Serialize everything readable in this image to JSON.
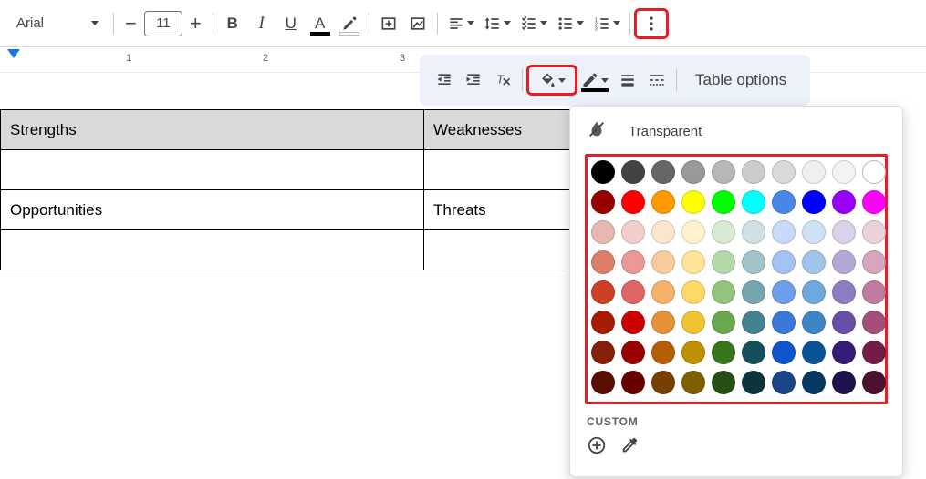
{
  "toolbar": {
    "font_name": "Arial",
    "font_size": "11",
    "text_color_bar": "#000000",
    "highlight_bar": "#ffffff"
  },
  "secondary_toolbar": {
    "border_color_bar": "#000000",
    "table_options_label": "Table options"
  },
  "ruler": {
    "n1": "1",
    "n2": "2",
    "n3": "3"
  },
  "table": {
    "r0c0": "Strengths",
    "r0c1": "Weaknesses",
    "r1c0": "",
    "r1c1": "",
    "r2c0": "Opportunities",
    "r2c1": "Threats",
    "r3c0": "",
    "r3c1": ""
  },
  "popup": {
    "transparent_label": "Transparent",
    "custom_label": "CUSTOM",
    "colors": [
      "#000000",
      "#434343",
      "#666666",
      "#999999",
      "#b7b7b7",
      "#cccccc",
      "#d9d9d9",
      "#efefef",
      "#f3f3f3",
      "#ffffff",
      "#980000",
      "#ff0000",
      "#ff9900",
      "#ffff00",
      "#00ff00",
      "#00ffff",
      "#4a86e8",
      "#0000ff",
      "#9900ff",
      "#ff00ff",
      "#e6b8af",
      "#f4cccc",
      "#fce5cd",
      "#fff2cc",
      "#d9ead3",
      "#d0e0e3",
      "#c9daf8",
      "#cfe2f3",
      "#d9d2e9",
      "#ead1dc",
      "#dd7e6b",
      "#ea9999",
      "#f9cb9c",
      "#ffe599",
      "#b6d7a8",
      "#a2c4c9",
      "#a4c2f4",
      "#9fc5e8",
      "#b4a7d6",
      "#d5a6bd",
      "#cc4125",
      "#e06666",
      "#f6b26b",
      "#ffd966",
      "#93c47d",
      "#76a5af",
      "#6d9eeb",
      "#6fa8dc",
      "#8e7cc3",
      "#c27ba0",
      "#a61c00",
      "#cc0000",
      "#e69138",
      "#f1c232",
      "#6aa84f",
      "#45818e",
      "#3c78d8",
      "#3d85c6",
      "#674ea7",
      "#a64d79",
      "#85200c",
      "#990000",
      "#b45f06",
      "#bf9000",
      "#38761d",
      "#134f5c",
      "#1155cc",
      "#0b5394",
      "#351c75",
      "#741b47",
      "#5b0f00",
      "#660000",
      "#783f04",
      "#7f6000",
      "#274e13",
      "#0c343d",
      "#1c4587",
      "#073763",
      "#20124d",
      "#4c1130"
    ]
  }
}
